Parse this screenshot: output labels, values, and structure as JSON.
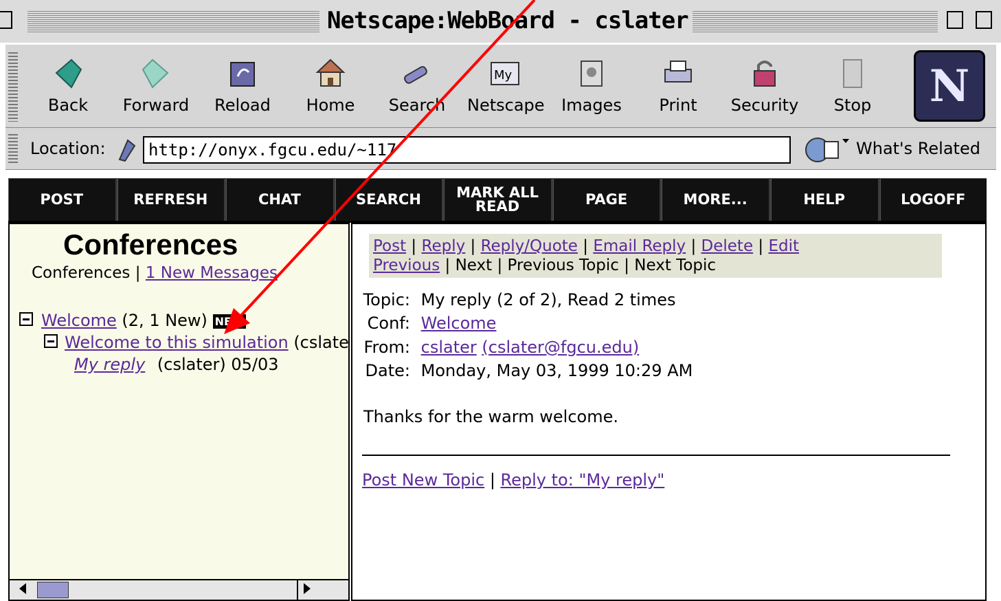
{
  "window": {
    "title": "Netscape:WebBoard - cslater"
  },
  "toolbar": {
    "buttons": [
      {
        "label": "Back",
        "icon": "back-icon"
      },
      {
        "label": "Forward",
        "icon": "forward-icon"
      },
      {
        "label": "Reload",
        "icon": "reload-icon"
      },
      {
        "label": "Home",
        "icon": "home-icon"
      },
      {
        "label": "Search",
        "icon": "search-icon"
      },
      {
        "label": "Netscape",
        "icon": "my-netscape-icon"
      },
      {
        "label": "Images",
        "icon": "images-icon"
      },
      {
        "label": "Print",
        "icon": "print-icon"
      },
      {
        "label": "Security",
        "icon": "security-lock-icon"
      },
      {
        "label": "Stop",
        "icon": "stop-icon"
      }
    ],
    "logo": "N"
  },
  "location": {
    "label": "Location:",
    "url": "http://onyx.fgcu.edu/~117",
    "related": "What's Related"
  },
  "nav": {
    "post": "POST",
    "refresh": "REFRESH",
    "chat": "CHAT",
    "search": "SEARCH",
    "mark_all_read": "MARK ALL READ",
    "page": "PAGE",
    "more": "MORE...",
    "help": "HELP",
    "logoff": "LOGOFF"
  },
  "left": {
    "title": "Conferences",
    "sub_text": "Conferences |",
    "sub_link": "1 New Messages",
    "tree": {
      "conf_link": "Welcome",
      "conf_count": "(2, 1 New)",
      "new_badge": "NEW",
      "topic_link": "Welcome to this simulation",
      "topic_author": "(cslater)",
      "reply_link": "My reply",
      "reply_meta": "(cslater) 05/03"
    }
  },
  "right": {
    "actions": {
      "post": "Post",
      "reply": "Reply",
      "reply_quote": "Reply/Quote",
      "email_reply": "Email Reply",
      "delete": "Delete",
      "edit": "Edit",
      "previous": "Previous",
      "next": "Next",
      "previous_topic": "Previous Topic",
      "next_topic": "Next Topic"
    },
    "meta": {
      "topic_label": "Topic:",
      "topic_value": "My reply (2 of 2), Read 2 times",
      "conf_label": "Conf:",
      "conf_value": "Welcome",
      "from_label": "From:",
      "from_name": "cslater",
      "from_email": "(cslater@fgcu.edu)",
      "date_label": "Date:",
      "date_value": "Monday, May 03, 1999 10:29 AM"
    },
    "body": "Thanks for the warm welcome.",
    "footer": {
      "post_new_topic": "Post New Topic",
      "reply_to": "Reply to: \"My reply\""
    }
  },
  "colors": {
    "link": "#5a2a9a",
    "annotation_arrow": "#ff0000",
    "left_bg": "#fafae8"
  }
}
